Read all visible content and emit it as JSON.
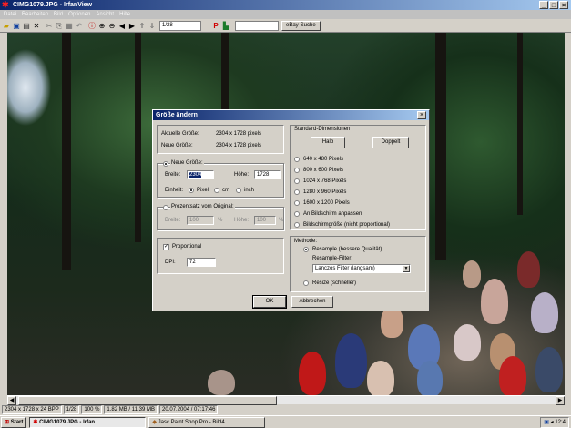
{
  "window": {
    "title": "CIMG1079.JPG - IrfanView",
    "controls": [
      "_",
      "□",
      "×"
    ]
  },
  "menu": [
    "Datei",
    "Bearbeiten",
    "Bild",
    "Optionen",
    "Ansicht",
    "Hilfe"
  ],
  "toolbar": {
    "icons": [
      "open-icon",
      "save-icon",
      "print-icon",
      "delete-icon",
      "cut-icon",
      "copy-icon",
      "paste-icon",
      "undo-icon",
      "info-icon",
      "zoom-in-icon",
      "zoom-out-icon",
      "prev-icon",
      "next-icon",
      "first-icon",
      "last-icon"
    ],
    "page_value": "1/28",
    "ebay_label": "eBay-Suche"
  },
  "dialog": {
    "title": "Größe ändern",
    "current_size_label": "Aktuelle Größe:",
    "current_size_value": "2304 x 1728 pixels",
    "new_size_label": "Neue Größe:",
    "new_size_value": "2304 x 1728 pixels",
    "new_size_group": {
      "radio_label": "Neue Größe:",
      "width_label": "Breite:",
      "width_value": "2304",
      "height_label": "Höhe:",
      "height_value": "1728",
      "unit_label": "Einheit:",
      "units": [
        "Pixel",
        "cm",
        "inch"
      ],
      "selected_unit": "Pixel"
    },
    "percent_group": {
      "radio_label": "Prozentsatz vom Original:",
      "width_label": "Breite:",
      "width_value": "100",
      "height_label": "Höhe:",
      "height_value": "100",
      "percent": "%"
    },
    "proportional_label": "Proportional",
    "dpi_label": "DPI:",
    "dpi_value": "72",
    "standard_group": {
      "title": "Standard-Dimensionen",
      "half_label": "Halb",
      "double_label": "Doppelt",
      "options": [
        "640 x 480 Pixels",
        "800 x 600 Pixels",
        "1024 x 768 Pixels",
        "1280 x 960 Pixels",
        "1600 x 1200 Pixels",
        "An Bildschirm anpassen",
        "Bildschirmgröße (nicht proportional)"
      ]
    },
    "method_group": {
      "title": "Methode:",
      "resample_label": "Resample (bessere Qualität)",
      "filter_label": "Resample-Filter:",
      "filter_value": "Lanczos Filter (langsam)",
      "resize_label": "Resize (schneller)"
    },
    "ok_label": "OK",
    "cancel_label": "Abbrechen"
  },
  "status": {
    "dims": "2304 x 1728 x 24 BPP",
    "index": "1/28",
    "zoom": "100 %",
    "size": "1.82 MB / 11.39 MB",
    "date": "20.07.2004 / 07:17:46"
  },
  "taskbar": {
    "start_label": "Start",
    "tasks": [
      "CIMG1079.JPG - Irfan...",
      "Jasc Paint Shop Pro - Bild4"
    ],
    "clock": "12:4"
  }
}
